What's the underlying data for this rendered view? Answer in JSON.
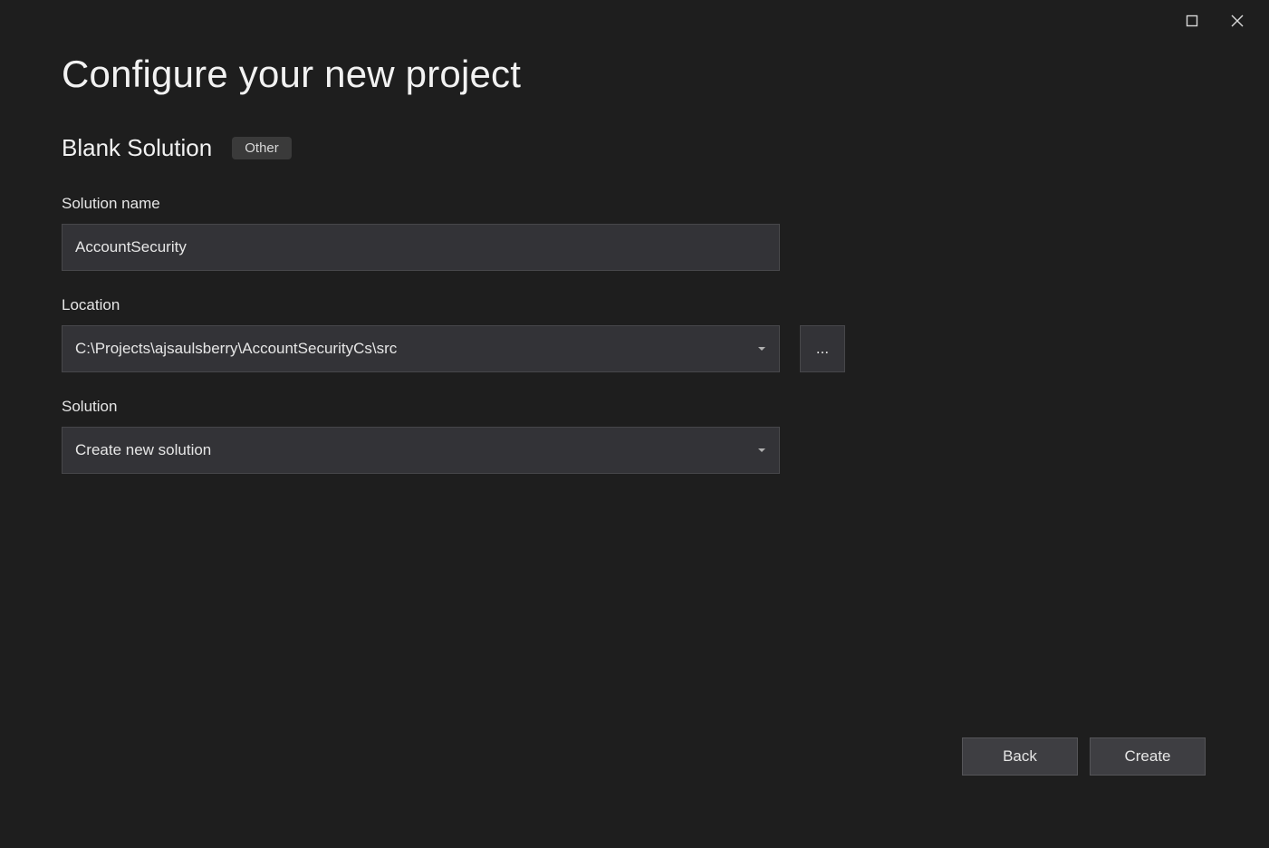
{
  "window": {
    "title": "Configure your new project"
  },
  "template": {
    "name": "Blank Solution",
    "tag": "Other"
  },
  "fields": {
    "solutionName": {
      "label": "Solution name",
      "value": "AccountSecurity"
    },
    "location": {
      "label": "Location",
      "value": "C:\\Projects\\ajsaulsberry\\AccountSecurityCs\\src",
      "browse": "..."
    },
    "solution": {
      "label": "Solution",
      "value": "Create new solution"
    }
  },
  "footer": {
    "back": "Back",
    "create": "Create"
  }
}
